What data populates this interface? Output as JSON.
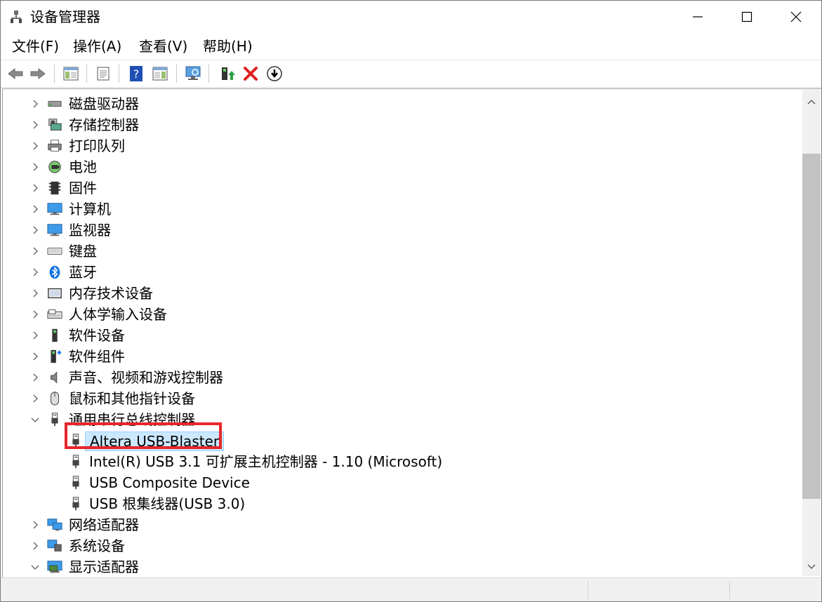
{
  "window": {
    "title": "设备管理器"
  },
  "menu": [
    {
      "label": "文件(F)"
    },
    {
      "label": "操作(A)"
    },
    {
      "label": "查看(V)"
    },
    {
      "label": "帮助(H)"
    }
  ],
  "toolbar": [
    {
      "name": "back-icon"
    },
    {
      "name": "forward-icon"
    },
    {
      "name": "show-hide-console-tree-icon"
    },
    {
      "name": "properties-icon"
    },
    {
      "name": "help-icon"
    },
    {
      "name": "view-icon"
    },
    {
      "name": "scan-hardware-changes-icon"
    },
    {
      "name": "update-driver-icon"
    },
    {
      "name": "uninstall-device-icon"
    },
    {
      "name": "disable-device-icon"
    }
  ],
  "tree": {
    "categories_before": [
      {
        "label": "磁盘驱动器",
        "icon": "disk-drive-icon"
      },
      {
        "label": "存储控制器",
        "icon": "storage-controller-icon"
      },
      {
        "label": "打印队列",
        "icon": "printer-icon"
      },
      {
        "label": "电池",
        "icon": "battery-icon"
      },
      {
        "label": "固件",
        "icon": "firmware-icon"
      },
      {
        "label": "计算机",
        "icon": "computer-icon"
      },
      {
        "label": "监视器",
        "icon": "monitor-icon"
      },
      {
        "label": "键盘",
        "icon": "keyboard-icon"
      },
      {
        "label": "蓝牙",
        "icon": "bluetooth-icon"
      },
      {
        "label": "内存技术设备",
        "icon": "memory-device-icon"
      },
      {
        "label": "人体学输入设备",
        "icon": "hid-icon"
      },
      {
        "label": "软件设备",
        "icon": "software-device-icon"
      },
      {
        "label": "软件组件",
        "icon": "software-component-icon"
      },
      {
        "label": "声音、视频和游戏控制器",
        "icon": "sound-icon"
      },
      {
        "label": "鼠标和其他指针设备",
        "icon": "mouse-icon"
      }
    ],
    "usb_category": {
      "label": "通用串行总线控制器",
      "icon": "usb-icon"
    },
    "usb_children": [
      {
        "label": "Altera USB-Blaster"
      },
      {
        "label": "Intel(R) USB 3.1 可扩展主机控制器 - 1.10 (Microsoft)"
      },
      {
        "label": "USB Composite Device"
      },
      {
        "label": "USB 根集线器(USB 3.0)"
      }
    ],
    "categories_after": [
      {
        "label": "网络适配器",
        "icon": "network-adapter-icon",
        "expanded": false
      },
      {
        "label": "系统设备",
        "icon": "system-device-icon",
        "expanded": false
      },
      {
        "label": "显示适配器",
        "icon": "display-adapter-icon",
        "expanded": true
      }
    ],
    "selected": "Altera USB-Blaster"
  },
  "colors": {
    "selection": "#cce8ff",
    "highlight": "#e8262b"
  }
}
